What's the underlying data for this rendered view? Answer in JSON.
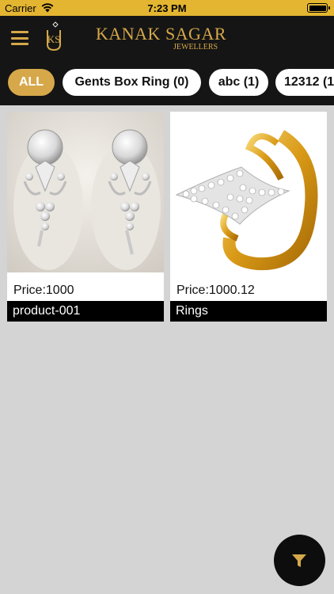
{
  "status_bar": {
    "carrier": "Carrier",
    "time": "7:23 PM",
    "wifi_icon": "wifi-icon",
    "battery_icon": "battery-icon"
  },
  "header": {
    "menu_icon": "hamburger-menu-icon",
    "logo_icon": "ks-emblem-logo",
    "brand_name": "KANAK SAGAR",
    "brand_subtitle": "JEWELLERS",
    "accent_color": "#d6a84a",
    "background_color": "#151515"
  },
  "categories": [
    {
      "label": "ALL",
      "active": true
    },
    {
      "label": "Gents Box Ring (0)",
      "active": false
    },
    {
      "label": "abc (1)",
      "active": false
    },
    {
      "label": "12312 (1",
      "active": false
    }
  ],
  "products": [
    {
      "price": "Price:1000",
      "name": "product-001",
      "image": "diamond-earrings-image"
    },
    {
      "price": "Price:1000.12",
      "name": "Rings",
      "image": "gold-diamond-ring-image"
    }
  ],
  "fab": {
    "icon": "filter-icon"
  }
}
